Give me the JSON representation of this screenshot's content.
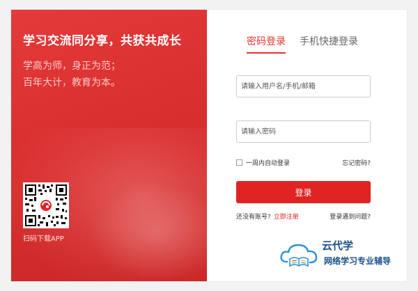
{
  "promo": {
    "slogan": "学习交流同分享，共获共成长",
    "motto_line1": "学高为师，身正为范；",
    "motto_line2": "百年大计，教育为本。",
    "qr_caption": "扫码下载APP",
    "qr_icon": "qr-code-icon"
  },
  "login": {
    "tabs": [
      {
        "label": "密码登录",
        "active": true
      },
      {
        "label": "手机快捷登录",
        "active": false
      }
    ],
    "username_placeholder": "请输入用户名/手机/邮箱",
    "username_value": "",
    "password_placeholder": "请输入密码",
    "password_value": "",
    "remember_label": "一周内自动登录",
    "remember_checked": false,
    "forgot_label": "忘记密码?",
    "submit_label": "登录",
    "no_account_text": "还没有账号?",
    "register_label": "立即注册",
    "problem_label": "登录遇到问题?"
  },
  "brand": {
    "name": "云代学",
    "tagline": "网络学习专业辅导",
    "logo_icon": "cloud-book-logo-icon"
  },
  "colors": {
    "accent": "#e02424",
    "brand_blue": "#1a4f8a",
    "panel_red": "#d92f2f"
  }
}
